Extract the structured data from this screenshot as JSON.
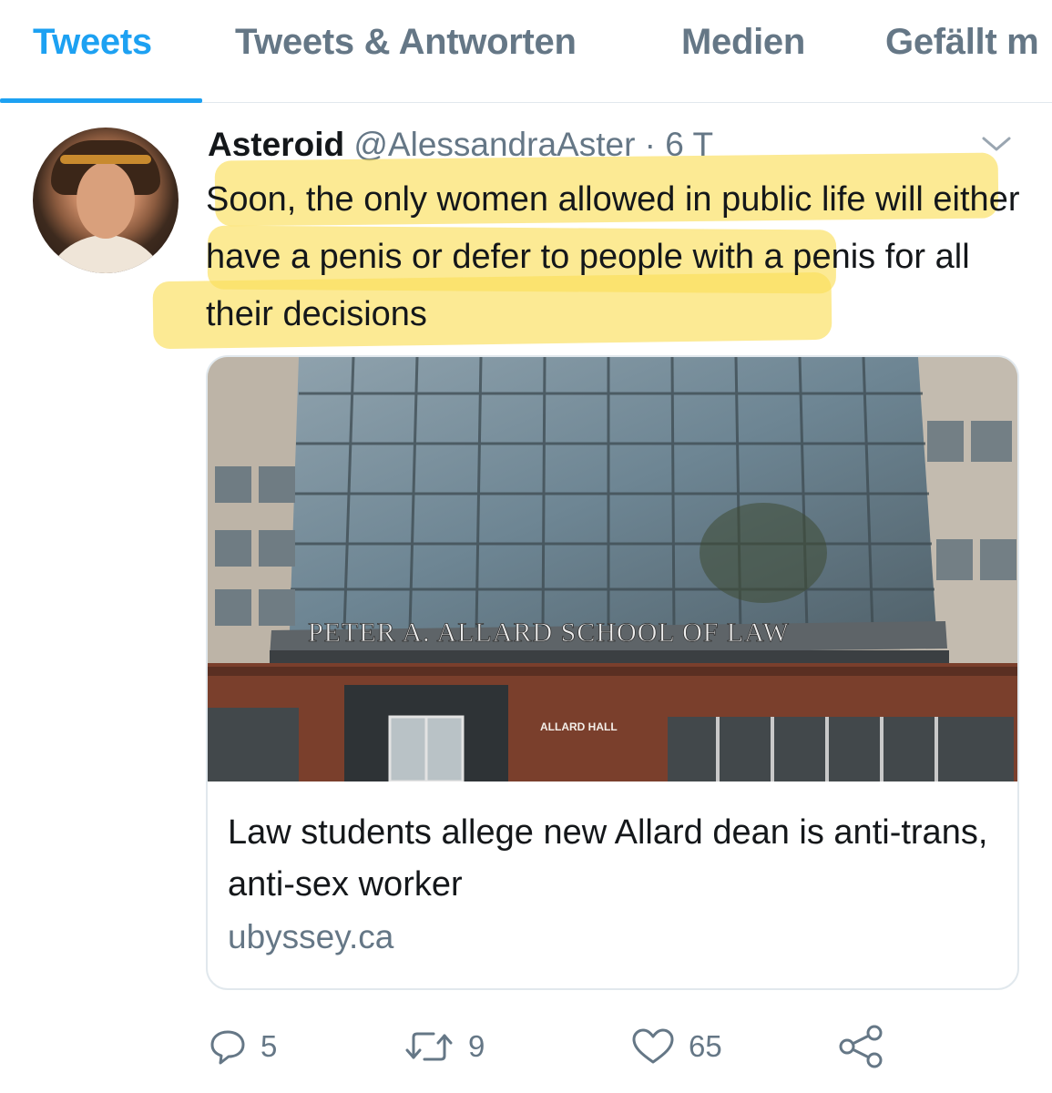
{
  "tabs": [
    {
      "label": "Tweets",
      "active": true
    },
    {
      "label": "Tweets & Antworten",
      "active": false
    },
    {
      "label": "Medien",
      "active": false
    },
    {
      "label": "Gefällt m",
      "active": false
    }
  ],
  "tweet": {
    "author_name": "Asteroid",
    "handle": "@AlessandraAster",
    "separator": "·",
    "time": "6 T",
    "text": "Soon, the only women allowed in public life will either have a penis or defer to people with a penis for all their decisions",
    "highlight_color": "#fade5a"
  },
  "card": {
    "image_sign": "PETER A. ALLARD SCHOOL OF LAW",
    "image_sublabel": "ALLARD HALL",
    "title": "Law students allege new Allard dean is anti-trans, anti-sex worker",
    "domain": "ubyssey.ca"
  },
  "actions": {
    "reply_count": "5",
    "retweet_count": "9",
    "like_count": "65",
    "reply_icon": "reply-icon",
    "retweet_icon": "retweet-icon",
    "like_icon": "heart-icon",
    "share_icon": "share-icon"
  },
  "colors": {
    "accent": "#1da1f2",
    "secondary_text": "#657786",
    "border": "#e1e8ed"
  }
}
